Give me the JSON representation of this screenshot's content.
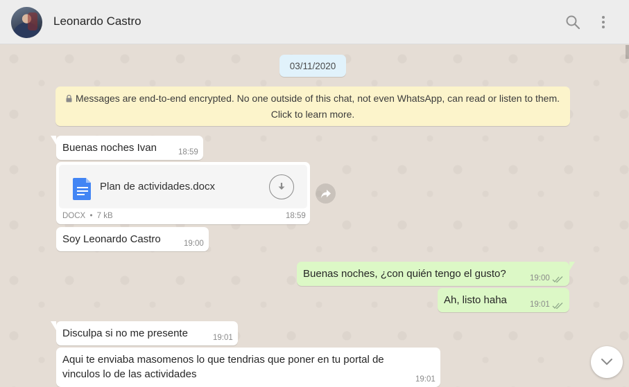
{
  "header": {
    "contact_name": "Leonardo Castro",
    "avatar_icon": "profile-photo",
    "search_icon": "search-icon",
    "menu_icon": "more-vertical-icon"
  },
  "chat": {
    "date": "03/11/2020",
    "encryption_notice": {
      "line1": "Messages are end-to-end encrypted. No one outside of this chat, not even WhatsApp, can read or listen to them.",
      "line2": "Click to learn more."
    },
    "messages": [
      {
        "direction": "in",
        "text": "Buenas noches Ivan",
        "time": "18:59"
      },
      {
        "direction": "in",
        "type": "document",
        "file_name": "Plan de actividades.docx",
        "file_type": "DOCX",
        "file_size": "7 kB",
        "meta_sep": "•",
        "time": "18:59"
      },
      {
        "direction": "in",
        "text": "Soy Leonardo Castro",
        "time": "19:00"
      },
      {
        "direction": "out",
        "text": "Buenas noches, ¿con quién tengo el gusto?",
        "time": "19:00",
        "status": "delivered"
      },
      {
        "direction": "out",
        "text": "Ah, listo haha",
        "time": "19:01",
        "status": "delivered"
      },
      {
        "direction": "in",
        "text": "Disculpa si no me presente",
        "time": "19:01"
      },
      {
        "direction": "in",
        "text_line1": "Aqui te enviaba masomenos lo que tendrias que poner en tu portal de",
        "text_line2": "vinculos lo de las actividades",
        "time": "19:01"
      }
    ]
  },
  "colors": {
    "header_bg": "#ededed",
    "chat_bg": "#e5ddd5",
    "incoming_bubble": "#ffffff",
    "outgoing_bubble": "#dcf8c6",
    "encryption_bg": "#fcf4cb",
    "date_bg": "#e1f2fb",
    "doc_icon": "#4285f4"
  }
}
